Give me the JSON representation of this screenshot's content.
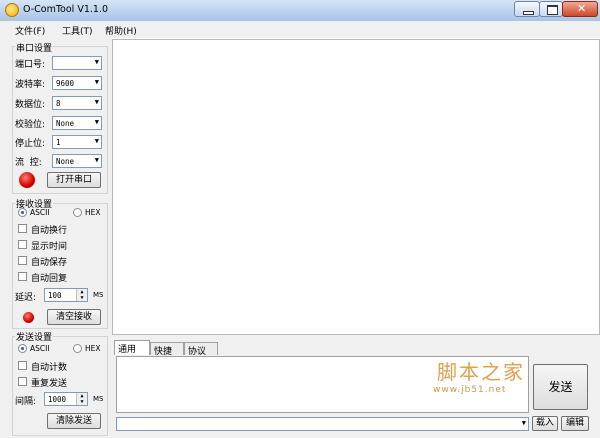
{
  "window": {
    "title": "O-ComTool V1.1.0"
  },
  "menu": [
    "文件(F)",
    "工具(T)",
    "帮助(H)"
  ],
  "serial": {
    "title": "串口设置",
    "fields": [
      {
        "label": "端口号:",
        "value": ""
      },
      {
        "label": "波特率:",
        "value": "9600"
      },
      {
        "label": "数据位:",
        "value": "8"
      },
      {
        "label": "校验位:",
        "value": "None"
      },
      {
        "label": "停止位:",
        "value": "1"
      },
      {
        "label": "流  控:",
        "value": "None"
      }
    ],
    "open_button": "打开串口",
    "status_color": "#e00000"
  },
  "receive": {
    "title": "接收设置",
    "mode_ascii": "ASCII",
    "mode_hex": "HEX",
    "selected_mode": "ASCII",
    "options": [
      "自动换行",
      "显示时间",
      "自动保存",
      "自动回复"
    ],
    "delay_label": "延迟:",
    "delay_value": "100",
    "delay_unit": "MS",
    "clear_button": "清空接收"
  },
  "send": {
    "title": "发送设置",
    "mode_ascii": "ASCII",
    "mode_hex": "HEX",
    "selected_mode": "ASCII",
    "options": [
      "自动计数",
      "重复发送"
    ],
    "interval_label": "间隔:",
    "interval_value": "1000",
    "interval_unit": "MS",
    "clear_button": "清除发送"
  },
  "tabs": [
    "通用",
    "快捷",
    "协议"
  ],
  "active_tab": "通用",
  "send_button": "发送",
  "load_button": "载入",
  "edit_button": "编辑",
  "watermark": {
    "text": "脚本之家",
    "url": "www.jb51.net"
  }
}
